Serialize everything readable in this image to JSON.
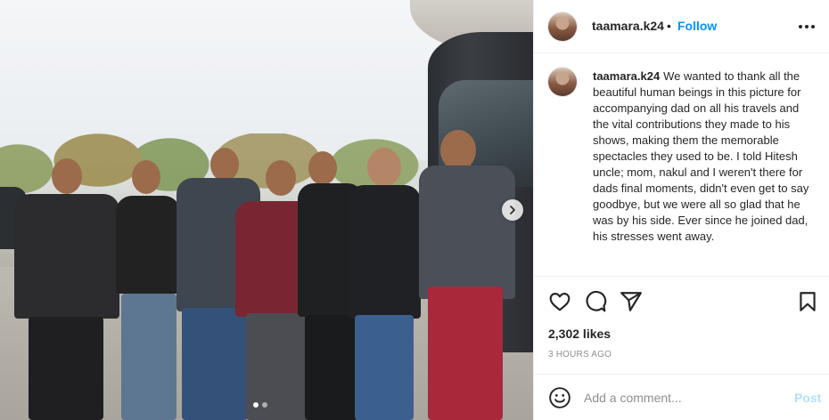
{
  "post": {
    "photo": {
      "description_icon": "group-photo",
      "carousel": {
        "total": 2,
        "current": 1
      }
    },
    "header": {
      "username": "taamara.k24",
      "bullet": "•",
      "follow_label": "Follow"
    },
    "caption": {
      "username": "taamara.k24",
      "text": "We wanted to thank all the beautiful human beings in this picture for accompanying dad on all his travels and the vital contributions they made to his shows, making them the memorable spectacles they used to be. I told Hitesh uncle; mom, nakul and I weren't there for dads final moments, didn't even get to say goodbye, but we were all so glad that he was by his side. Ever since he joined dad, his stresses went away."
    },
    "stats": {
      "likes": "2,302 likes",
      "time_ago": "3 hours ago"
    },
    "comment": {
      "placeholder": "Add a comment...",
      "post_label": "Post"
    }
  },
  "colors": {
    "link": "#0095f6",
    "post_disabled": "#b2dffc",
    "muted": "#8e8e8e",
    "text": "#262626"
  }
}
